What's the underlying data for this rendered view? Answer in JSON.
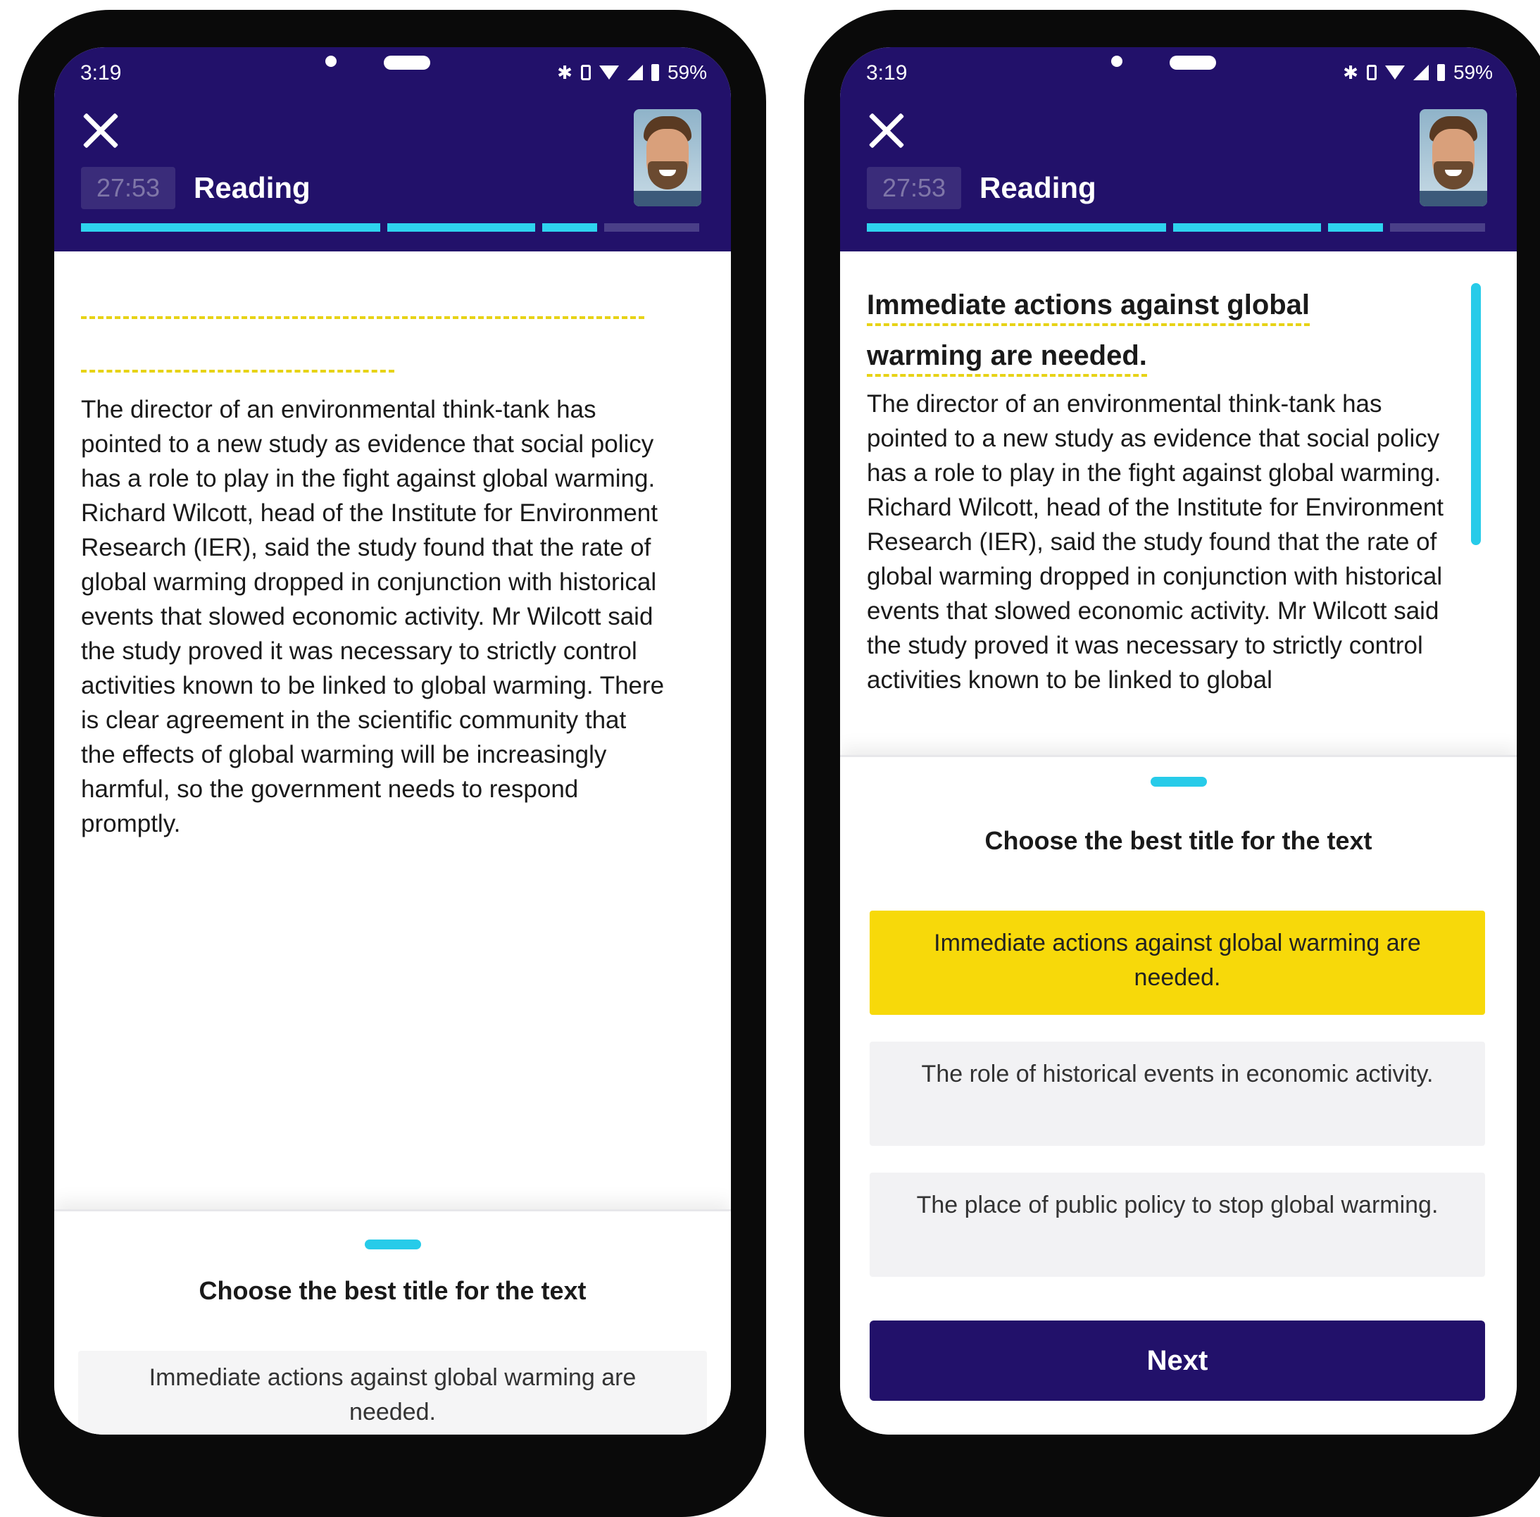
{
  "status_bar": {
    "time": "3:19",
    "battery": "59%"
  },
  "header": {
    "timer": "27:53",
    "section": "Reading"
  },
  "passage": {
    "title": "Immediate actions against global warming are needed.",
    "title_line1": "Immediate actions against global",
    "title_line2": "warming are needed.",
    "text_full": "The director of an environmental think-tank has pointed to a new study as evidence that social policy has a role to play in the fight against global warming. Richard Wilcott, head of the Institute for Environment Research (IER), said the study found that the rate of global warming dropped in conjunction with historical events that slowed economic activity. Mr Wilcott said the study proved it was necessary to strictly control activities known to be linked to global warming. There is clear agreement in the scientific community that the effects of global warming will be increasingly harmful, so the government needs to respond promptly.",
    "text_truncated": "The director of an environmental think-tank has pointed to a new study as evidence that social policy has a role to play in the fight against global warming. Richard Wilcott, head of the Institute for Environment Research (IER), said the study found that the rate of global warming dropped in conjunction with historical events that slowed economic activity. Mr Wilcott said the study proved it was necessary to strictly control activities known to be linked to global"
  },
  "question": {
    "prompt": "Choose the best title for the text",
    "options": [
      {
        "label": "Immediate actions against global warming are needed.",
        "selected": true
      },
      {
        "label": "The role of historical events in economic activity.",
        "selected": false
      },
      {
        "label": "The place of public policy to stop global warming.",
        "selected": false
      }
    ]
  },
  "next_button": {
    "label": "Next"
  },
  "progress": {
    "segments": [
      1.0,
      1.0,
      0.38,
      0.0
    ]
  },
  "colors": {
    "header": "#22116a",
    "accent": "#2ed3ee",
    "selected": "#f7d90a",
    "title_underline": "#e7d315"
  },
  "icons": [
    "close-icon",
    "bluetooth-icon",
    "vibrate-icon",
    "wifi-icon",
    "signal-icon",
    "battery-icon"
  ]
}
